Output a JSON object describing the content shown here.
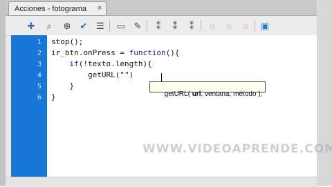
{
  "tab": {
    "title": "Acciones - fotograma",
    "close_glyph": "×"
  },
  "toolbar": {
    "buttons": [
      {
        "icon": "add-statement-icon",
        "glyph": "✚"
      },
      {
        "icon": "find-icon",
        "glyph": "⌕"
      },
      {
        "icon": "target-icon",
        "glyph": "⊕"
      },
      {
        "icon": "check-syntax-icon",
        "glyph": "✔"
      },
      {
        "icon": "auto-format-icon",
        "glyph": "☰"
      },
      {
        "icon": "code-hint-icon",
        "glyph": "▭"
      },
      {
        "icon": "debug-options-icon",
        "glyph": "✎"
      },
      {
        "icon": "collapse-between-braces-icon",
        "glyph": "⁑"
      },
      {
        "icon": "collapse-selection-icon",
        "glyph": "⁑"
      },
      {
        "icon": "expand-all-icon",
        "glyph": "⁑"
      },
      {
        "icon": "apply-block-comment-icon",
        "glyph": "◌"
      },
      {
        "icon": "apply-line-comment-icon",
        "glyph": "◌"
      },
      {
        "icon": "remove-comment-icon",
        "glyph": "◌"
      },
      {
        "icon": "show-hide-toolbox-icon",
        "glyph": "▣"
      }
    ]
  },
  "editor": {
    "line_numbers": [
      "1",
      "2",
      "3",
      "4",
      "5",
      "6"
    ],
    "lines": [
      "stop();",
      "ir_btn.onPress = function(){",
      "    if(!texto.length){",
      "        getURL(\"\")",
      "    }",
      "}"
    ]
  },
  "code_hint": {
    "text": "getURL( url, ventana, método );",
    "bold_param": "url"
  },
  "watermark": "WWW.VIDEOAPRENDE.COM",
  "colors": {
    "gutter": "#1877d6",
    "keyword": "#1a1ab8"
  }
}
